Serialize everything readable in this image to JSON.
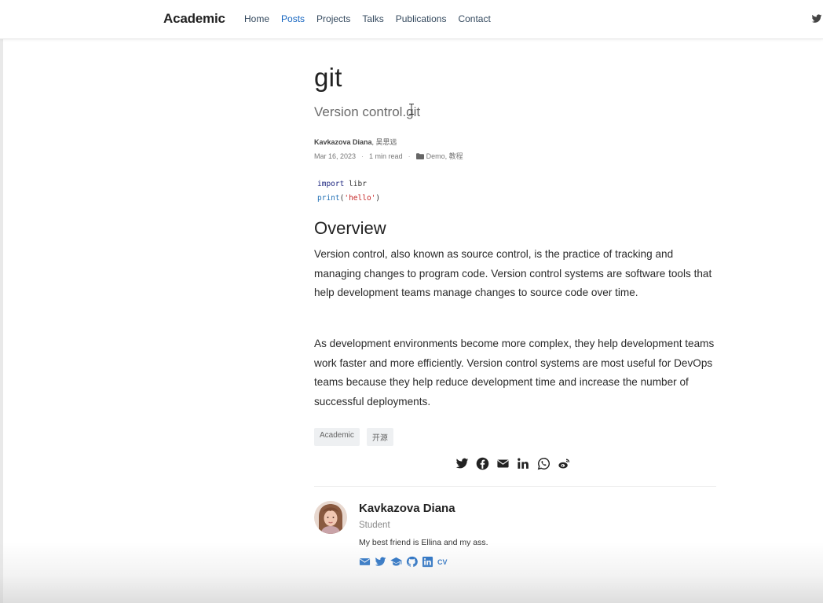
{
  "navbar": {
    "brand": "Academic",
    "links": [
      {
        "label": "Home",
        "active": false
      },
      {
        "label": "Posts",
        "active": true
      },
      {
        "label": "Projects",
        "active": false
      },
      {
        "label": "Talks",
        "active": false
      },
      {
        "label": "Publications",
        "active": false
      },
      {
        "label": "Contact",
        "active": false
      }
    ],
    "right_icon": "twitter-icon"
  },
  "article": {
    "title": "git",
    "subtitle": "Version control.git",
    "authors": {
      "primary": "Kavkazova Diana",
      "secondary": ", 吴思远"
    },
    "meta": {
      "date": "Mar 16, 2023",
      "read_time": "1 min read",
      "categories": "Demo, 教程"
    },
    "code": {
      "line1_keyword": "import",
      "line1_rest": " libr",
      "line2_fn": "print",
      "line2_open": "(",
      "line2_string": "'hello'",
      "line2_close": ")"
    },
    "heading": "Overview",
    "paragraphs": [
      "Version control, also known as source control, is the practice of tracking and managing changes to program code. Version control systems are software tools that help development teams manage changes to source code over time.",
      "As development environments become more complex, they help development teams work faster and more efficiently. Version control systems are most useful for DevOps teams because they help reduce development time and increase the number of successful deployments."
    ],
    "tags": [
      "Academic",
      "开源"
    ],
    "share_icons": [
      "twitter-icon",
      "facebook-icon",
      "email-icon",
      "linkedin-icon",
      "whatsapp-icon",
      "weibo-icon"
    ]
  },
  "author_card": {
    "name": "Kavkazova Diana",
    "role": "Student",
    "bio": "My best friend is Ellina and my ass.",
    "link_icons": [
      "email-icon",
      "twitter-icon",
      "graduation-cap-icon",
      "github-icon",
      "linkedin-icon"
    ],
    "cv_label": "CV"
  },
  "colors": {
    "accent": "#1565c0",
    "text": "#2a2a2a",
    "muted": "#777777",
    "tag_bg": "#eef0f2"
  }
}
